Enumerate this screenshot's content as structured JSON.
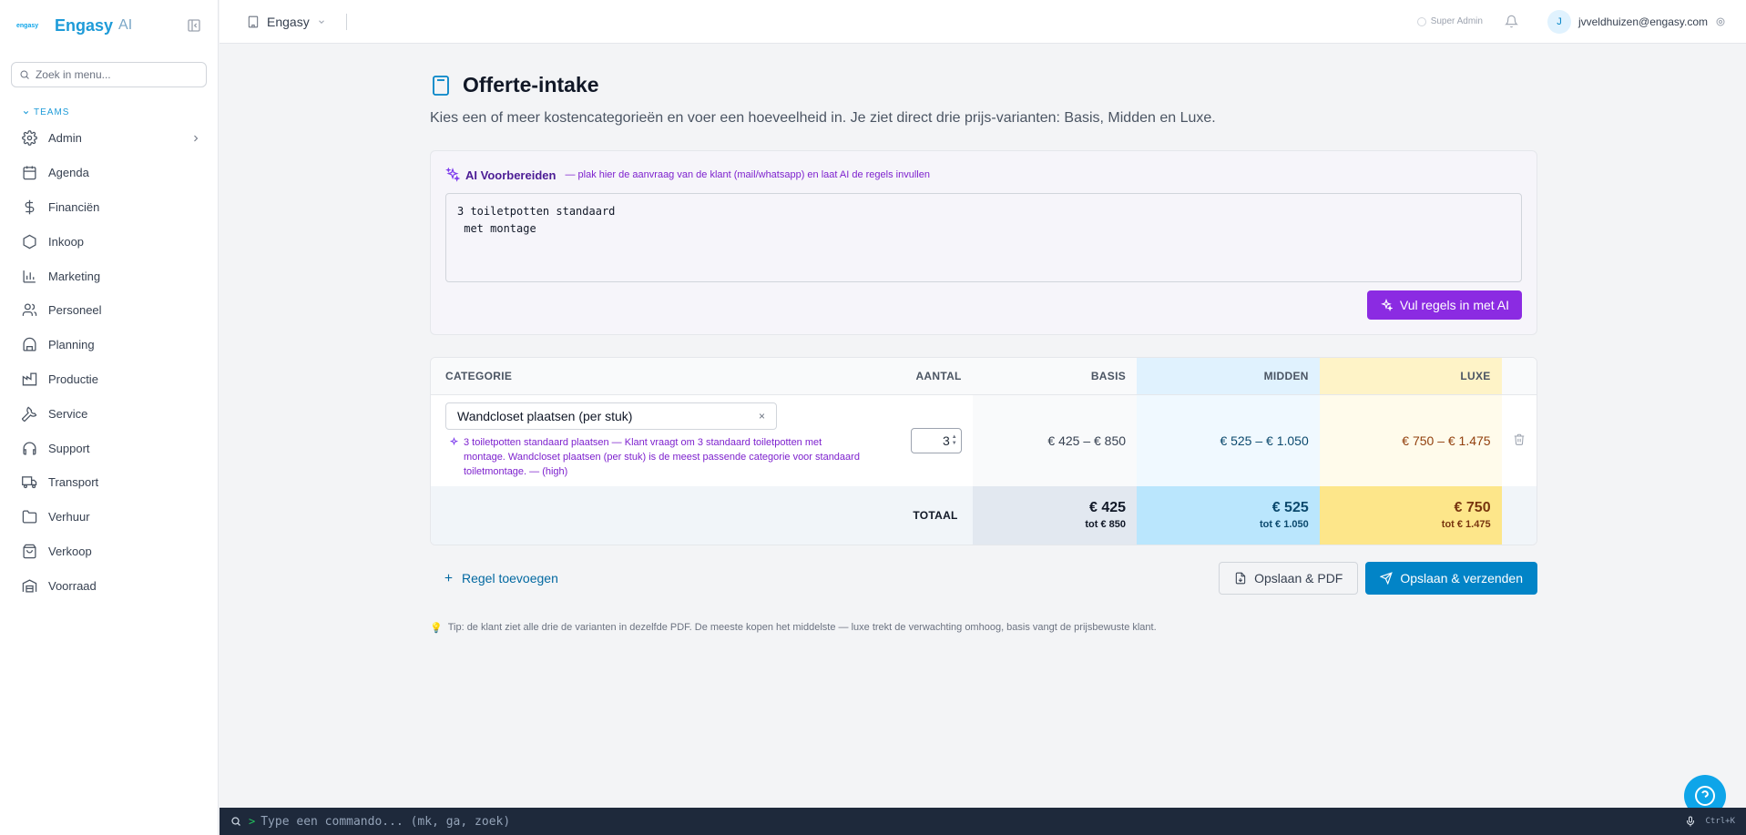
{
  "brand": {
    "logo_text": "engasy",
    "name": "Engasy",
    "suffix": "AI"
  },
  "sidebar": {
    "search_placeholder": "Zoek in menu...",
    "section_label": "TEAMS",
    "items": [
      {
        "label": "Admin",
        "icon": "gear-icon"
      },
      {
        "label": "Agenda",
        "icon": "calendar-icon"
      },
      {
        "label": "Financiën",
        "icon": "dollar-icon"
      },
      {
        "label": "Inkoop",
        "icon": "hexagon-icon"
      },
      {
        "label": "Marketing",
        "icon": "bar-chart-icon"
      },
      {
        "label": "Personeel",
        "icon": "users-icon"
      },
      {
        "label": "Planning",
        "icon": "gauge-icon"
      },
      {
        "label": "Productie",
        "icon": "factory-icon"
      },
      {
        "label": "Service",
        "icon": "wrench-icon"
      },
      {
        "label": "Support",
        "icon": "headphones-icon"
      },
      {
        "label": "Transport",
        "icon": "truck-icon"
      },
      {
        "label": "Verhuur",
        "icon": "folder-icon"
      },
      {
        "label": "Verkoop",
        "icon": "shopping-bag-icon"
      },
      {
        "label": "Voorraad",
        "icon": "warehouse-icon"
      }
    ]
  },
  "topbar": {
    "org_name": "Engasy",
    "role": "Super Admin",
    "avatar_initial": "J",
    "email": "jvveldhuizen@engasy.com"
  },
  "page": {
    "title": "Offerte-intake",
    "subtitle": "Kies een of meer kostencategorieën en voer een hoeveelheid in. Je ziet direct drie prijs-varianten: Basis, Midden en Luxe."
  },
  "ai_prepare": {
    "title": "AI Voorbereiden",
    "hint": "— plak hier de aanvraag van de klant (mail/whatsapp) en laat AI de regels invullen",
    "text": "3 toiletpotten standaard\n met montage",
    "button_label": "Vul regels in met AI"
  },
  "table": {
    "headers": {
      "category": "CATEGORIE",
      "quantity": "AANTAL",
      "basis": "BASIS",
      "midden": "MIDDEN",
      "luxe": "LUXE"
    },
    "rows": [
      {
        "category": "Wandcloset plaatsen (per stuk)",
        "clear": "×",
        "ai_note": "3 toiletpotten standaard plaatsen — Klant vraagt om 3 standaard toiletpotten met montage. Wandcloset plaatsen (per stuk) is de meest passende categorie voor standaard toiletmontage. — (high)",
        "quantity": "3",
        "basis": "€ 425 – € 850",
        "midden": "€ 525 – € 1.050",
        "luxe": "€ 750 – € 1.475"
      }
    ],
    "total": {
      "label": "TOTAAL",
      "basis_from": "€ 425",
      "basis_to": "tot € 850",
      "midden_from": "€ 525",
      "midden_to": "tot € 1.050",
      "luxe_from": "€ 750",
      "luxe_to": "tot € 1.475"
    }
  },
  "actions": {
    "add_row": "Regel toevoegen",
    "save_pdf": "Opslaan & PDF",
    "save_send": "Opslaan & verzenden"
  },
  "tip": "Tip: de klant ziet alle drie de varianten in dezelfde PDF. De meeste kopen het middelste — luxe trekt de verwachting omhoog, basis vangt de prijsbewuste klant.",
  "command_bar": {
    "prompt": ">",
    "placeholder": "Type een commando... (mk, ga, zoek)",
    "shortcut": "Ctrl+K"
  },
  "colors": {
    "brand": "#1e9bd8",
    "ai_purple": "#8b2be2",
    "primary": "#0284c7",
    "midden_bg": "#e0f2fe",
    "luxe_bg": "#fef3c7"
  }
}
